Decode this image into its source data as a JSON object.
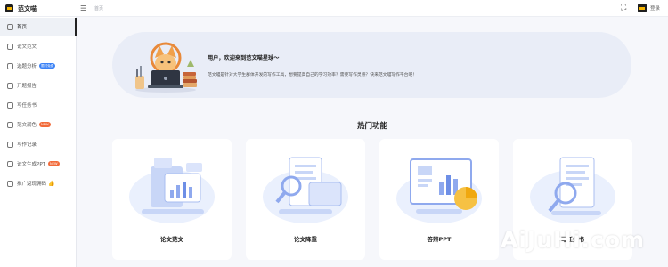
{
  "app": {
    "name": "范文喵",
    "breadcrumb": "首页",
    "login_label": "登录",
    "icons": {
      "brand": "cat-logo-icon",
      "collapse": "menu-collapse-icon",
      "fullscreen": "fullscreen-icon",
      "avatar": "user-avatar-icon"
    }
  },
  "sidebar": {
    "items": [
      {
        "label": "首页",
        "icon": "home-icon",
        "active": true
      },
      {
        "label": "论文范文",
        "icon": "document-icon"
      },
      {
        "label": "选题分析",
        "icon": "analysis-icon",
        "badge": "限时免费"
      },
      {
        "label": "开题报告",
        "icon": "report-icon"
      },
      {
        "label": "写任务书",
        "icon": "task-icon"
      },
      {
        "label": "范文润色",
        "icon": "polish-icon",
        "badge": "NEW"
      },
      {
        "label": "写作记录",
        "icon": "history-icon"
      },
      {
        "label": "论文生成PPT",
        "icon": "ppt-icon",
        "badge": "NEW"
      },
      {
        "label": "推广返现佣码",
        "icon": "gift-icon",
        "thumb": "👍"
      }
    ]
  },
  "banner": {
    "title": "用户，欢迎来到范文喵星球～",
    "description": "范文喵是针对大学生群体开发的写作工具，想要提高自己的学习效率？需要写作灵感？快来范文喵写作平台吧！",
    "illustration": "cat-at-laptop-illustration"
  },
  "section": {
    "title": "热门功能"
  },
  "cards": [
    {
      "label": "论文范文",
      "illustration": "document-chart-illustration"
    },
    {
      "label": "论文降重",
      "illustration": "document-search-illustration"
    },
    {
      "label": "答辩PPT",
      "illustration": "presentation-chart-illustration"
    },
    {
      "label": "写任务书",
      "illustration": "document-magnifier-illustration"
    }
  ],
  "watermark": "AiJuHi.com",
  "colors": {
    "accent": "#f5b400",
    "illustration_blue": "#a9bef0",
    "badge_orange": "#f26b3a",
    "banner_bg": "#e9edf7"
  }
}
